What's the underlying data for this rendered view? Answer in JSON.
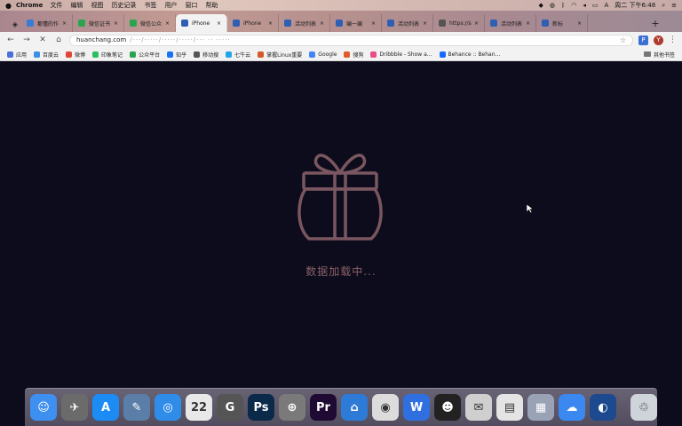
{
  "menubar": {
    "app": "Chrome",
    "menus": [
      "文件",
      "编辑",
      "视图",
      "历史记录",
      "书签",
      "用户",
      "窗口",
      "帮助"
    ],
    "clock": "周二 下午6:48"
  },
  "tabs": [
    {
      "title": "都懂的作",
      "color": "#3a7bd5",
      "active": false
    },
    {
      "title": "微信证书",
      "color": "#2aa44f",
      "active": false
    },
    {
      "title": "微信公众",
      "color": "#2aa44f",
      "active": false
    },
    {
      "title": "iPhone",
      "color": "#2f5fb3",
      "active": true
    },
    {
      "title": "iPhone",
      "color": "#2f5fb3",
      "active": false
    },
    {
      "title": "活动列表",
      "color": "#2f5fb3",
      "active": false
    },
    {
      "title": "编一编",
      "color": "#2f5fb3",
      "active": false
    },
    {
      "title": "活动列表",
      "color": "#2f5fb3",
      "active": false
    },
    {
      "title": "https://s",
      "color": "#555555",
      "active": false
    },
    {
      "title": "活动列表",
      "color": "#2f5fb3",
      "active": false
    },
    {
      "title": "新标",
      "color": "#2f5fb3",
      "active": false
    }
  ],
  "omnibox": {
    "url": "huanchang.com",
    "rest": "/···/·····/·····/·····/··· ·· ·····"
  },
  "toolbar": {
    "ext_label": "P",
    "profile_label": "Y"
  },
  "bookmarks": [
    {
      "label": "应用",
      "color": "#4a6fd6"
    },
    {
      "label": "百度云",
      "color": "#3a8ee6"
    },
    {
      "label": "微博",
      "color": "#e2463a"
    },
    {
      "label": "印象笔记",
      "color": "#2dbe60"
    },
    {
      "label": "公众平台",
      "color": "#2aa44f"
    },
    {
      "label": "知乎",
      "color": "#1772f6"
    },
    {
      "label": "移动搜",
      "color": "#555555"
    },
    {
      "label": "七牛云",
      "color": "#23a4e8"
    },
    {
      "label": "掌握Linux重要",
      "color": "#d8572a"
    },
    {
      "label": "Google",
      "color": "#4285f4"
    },
    {
      "label": "搜狗",
      "color": "#e05b2a"
    },
    {
      "label": "Dribbble - Show a...",
      "color": "#ea4c89"
    },
    {
      "label": "Behance :: Behan...",
      "color": "#1769ff"
    }
  ],
  "bookmarks_other": "其他书签",
  "content": {
    "loading_text": "数据加载中...",
    "accent": "#8a6068"
  },
  "dock": [
    {
      "name": "finder",
      "glyph": "☺",
      "color": "#3d8ff0"
    },
    {
      "name": "launchpad",
      "glyph": "✈",
      "color": "#6b6b6b"
    },
    {
      "name": "app-store",
      "glyph": "A",
      "color": "#1c8cf4"
    },
    {
      "name": "preview",
      "glyph": "✎",
      "color": "#5b7ea8"
    },
    {
      "name": "safari",
      "glyph": "◎",
      "color": "#2f8ce8"
    },
    {
      "name": "calendar",
      "glyph": "22",
      "color": "#e8e8e8"
    },
    {
      "name": "sync",
      "glyph": "G",
      "color": "#555555"
    },
    {
      "name": "photoshop",
      "glyph": "Ps",
      "color": "#0b2a4a"
    },
    {
      "name": "scanner",
      "glyph": "⊕",
      "color": "#7a7a7a"
    },
    {
      "name": "premiere",
      "glyph": "Pr",
      "color": "#1f0a33"
    },
    {
      "name": "keynote",
      "glyph": "⌂",
      "color": "#2d7bd6"
    },
    {
      "name": "chrome",
      "glyph": "◉",
      "color": "#dcdcdc"
    },
    {
      "name": "wps",
      "glyph": "W",
      "color": "#2f6fe0"
    },
    {
      "name": "qq",
      "glyph": "☻",
      "color": "#222222"
    },
    {
      "name": "wechat",
      "glyph": "✉",
      "color": "#cfcfcf"
    },
    {
      "name": "notes",
      "glyph": "▤",
      "color": "#e4e4e4"
    },
    {
      "name": "grid-app",
      "glyph": "▦",
      "color": "#9aa3b5"
    },
    {
      "name": "baidu-netdisk",
      "glyph": "☁",
      "color": "#3a88f0"
    },
    {
      "name": "vpn",
      "glyph": "◐",
      "color": "#1d4a8f"
    },
    {
      "name": "trash",
      "glyph": "♲",
      "color": "#cfd3da"
    }
  ]
}
